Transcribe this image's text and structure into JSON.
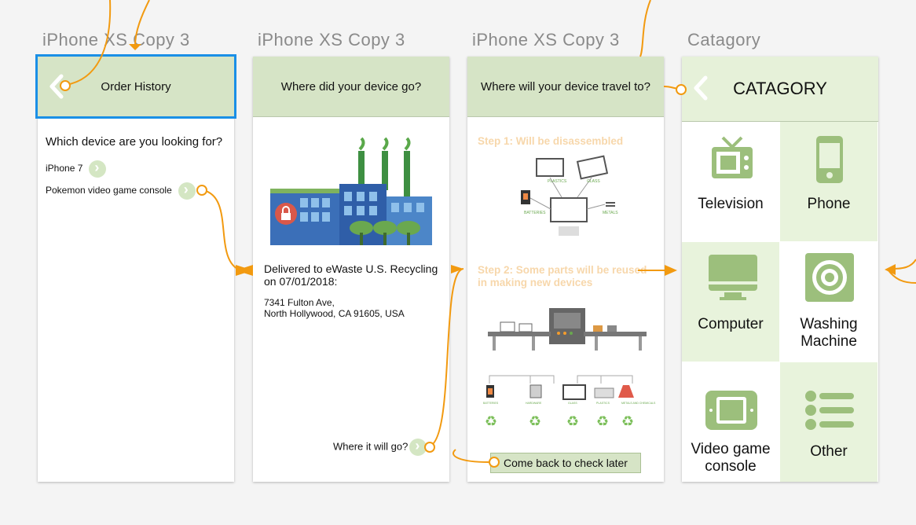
{
  "artboards": [
    {
      "title": "iPhone XS Copy 3"
    },
    {
      "title": "iPhone XS Copy 3"
    },
    {
      "title": "iPhone XS Copy 3"
    },
    {
      "title": "Catagory"
    }
  ],
  "order_history": {
    "header": "Order History",
    "question": "Which device are you looking for?",
    "items": [
      "iPhone 7",
      "Pokemon video game console"
    ]
  },
  "where_device_go": {
    "header": "Where did your device go?",
    "delivered": "Delivered to eWaste U.S. Recycling on 07/01/2018:",
    "address_line1": "7341 Fulton Ave,",
    "address_line2": "North Hollywood, CA 91605, USA",
    "link": "Where it will go?"
  },
  "travel": {
    "header": "Where will your device travel to?",
    "step1": "Step 1: Will be disassembled",
    "step2": "Step 2: Some parts will be reused in making new devices",
    "button": "Come back to check later",
    "parts": [
      "BATTERIES",
      "PLASTICS",
      "GLASS",
      "METALS"
    ],
    "bins": [
      "BATTERIES",
      "HARDWARE",
      "GLASS",
      "PLASTICS",
      "METALS AND CHEMICALS"
    ]
  },
  "category": {
    "header": "CATAGORY",
    "items": [
      "Television",
      "Phone",
      "Computer",
      "Washing Machine",
      "Video game console",
      "Other"
    ]
  },
  "colors": {
    "accent_green": "#9cbf7c",
    "header_green": "#d6e4c6",
    "light_green": "#e8f3dc",
    "flow_orange": "#f29a10",
    "selection_blue": "#1a8fe6"
  }
}
